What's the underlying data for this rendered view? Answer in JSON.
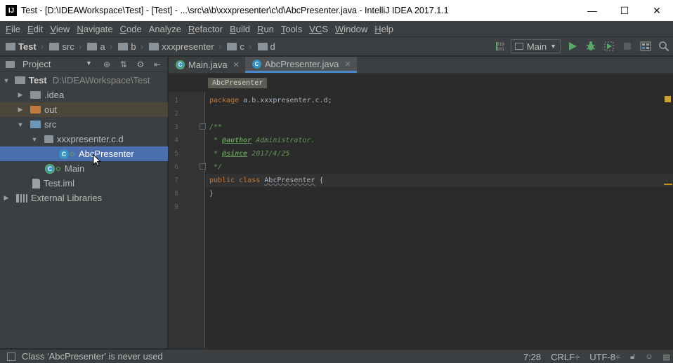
{
  "window": {
    "title": "Test - [D:\\IDEAWorkspace\\Test] - [Test] - ...\\src\\a\\b\\xxxpresenter\\c\\d\\AbcPresenter.java - IntelliJ IDEA 2017.1.1",
    "app_icon": "IJ",
    "minimize": "—",
    "maximize": "☐",
    "close": "✕"
  },
  "menu": [
    {
      "mn": "F",
      "rest": "ile"
    },
    {
      "mn": "E",
      "rest": "dit"
    },
    {
      "mn": "V",
      "rest": "iew"
    },
    {
      "mn": "N",
      "rest": "avigate"
    },
    {
      "mn": "C",
      "rest": "ode"
    },
    {
      "mn": "",
      "rest": "Analyze"
    },
    {
      "mn": "R",
      "rest": "efactor"
    },
    {
      "mn": "B",
      "rest": "uild"
    },
    {
      "mn": "R",
      "rest": "un"
    },
    {
      "mn": "T",
      "rest": "ools"
    },
    {
      "mn": "VC",
      "rest": "S"
    },
    {
      "mn": "W",
      "rest": "indow"
    },
    {
      "mn": "H",
      "rest": "elp"
    }
  ],
  "navbar": {
    "crumbs": [
      "Test",
      "src",
      "a",
      "b",
      "xxxpresenter",
      "c",
      "d"
    ],
    "run_config": "Main",
    "colors": {
      "run": "#59a869",
      "debug": "#59a869"
    }
  },
  "project_panel": {
    "title": "Project",
    "tree": [
      {
        "label": "Test",
        "path": "D:\\IDEAWorkspace\\Test",
        "arrow": "▼",
        "level": 0,
        "icon": "project-folder-icon"
      },
      {
        "label": ".idea",
        "arrow": "▶",
        "level": 1,
        "icon": "folder-icon"
      },
      {
        "label": "out",
        "arrow": "▶",
        "level": 1,
        "icon": "excluded-folder-icon"
      },
      {
        "label": "src",
        "arrow": "▼",
        "level": 1,
        "icon": "source-folder-icon"
      },
      {
        "label": "xxxpresenter.c.d",
        "arrow": "▼",
        "level": 2,
        "icon": "package-icon"
      },
      {
        "label": "AbcPresenter",
        "arrow": "",
        "level": 3,
        "icon": "class-icon",
        "selected": true
      },
      {
        "label": "Main",
        "arrow": "",
        "level": 2,
        "icon": "main-class-icon"
      },
      {
        "label": "Test.iml",
        "arrow": "",
        "level": 1,
        "icon": "iml-file-icon"
      },
      {
        "label": "External Libraries",
        "arrow": "▶",
        "level": 0,
        "icon": "library-icon"
      }
    ]
  },
  "editor": {
    "tabs": [
      {
        "label": "Main.java",
        "active": false
      },
      {
        "label": "AbcPresenter.java",
        "active": true
      }
    ],
    "breadcrumb": "AbcPresenter",
    "line_numbers": [
      "1",
      "2",
      "3",
      "4",
      "5",
      "6",
      "7",
      "8",
      "9"
    ],
    "code": {
      "l1_kw": "package",
      "l1_rest": " a.b.xxxpresenter.c.d;",
      "l3": "/**",
      "l4_star": " * ",
      "l4_tag": "@author",
      "l4_rest": " Administrator.",
      "l5_star": " * ",
      "l5_tag": "@since",
      "l5_rest": " 2017/4/25",
      "l6": " */",
      "l7_kw": "public class",
      "l7_name": "AbcPresenter",
      "l7_rest": " {",
      "l8": "}"
    }
  },
  "status": {
    "message": "Class 'AbcPresenter' is never used",
    "position": "7:28",
    "line_sep": "CRLF÷",
    "encoding": "UTF-8÷"
  }
}
